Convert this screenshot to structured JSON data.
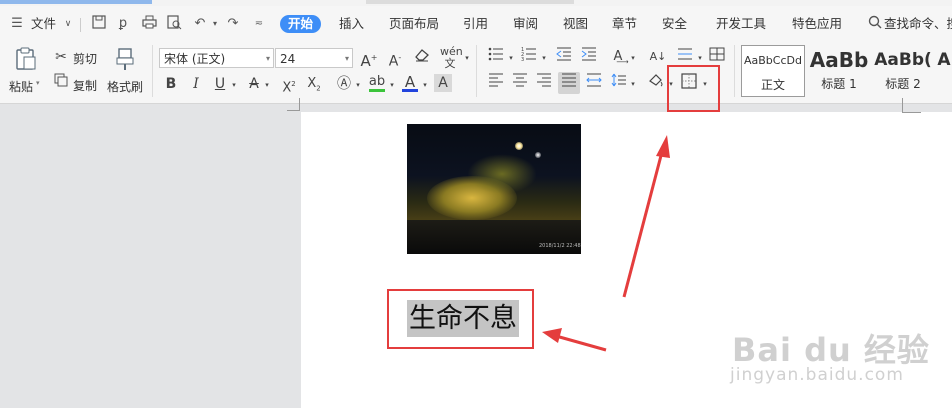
{
  "menu": {
    "file_label": "文件",
    "tabs": [
      {
        "label": "开始",
        "active": true
      },
      {
        "label": "插入"
      },
      {
        "label": "页面布局"
      },
      {
        "label": "引用"
      },
      {
        "label": "审阅"
      },
      {
        "label": "视图"
      },
      {
        "label": "章节"
      },
      {
        "label": "安全"
      },
      {
        "label": "开发工具"
      },
      {
        "label": "特色应用"
      }
    ],
    "search_label": "查找命令、搜"
  },
  "ribbon": {
    "paste_label": "粘贴",
    "cut_label": "剪切",
    "copy_label": "复制",
    "format_painter_label": "格式刷",
    "font_name": "宋体 (正文)",
    "font_size": "24",
    "styles": [
      {
        "sample": "AaBbCcDd",
        "name": "正文"
      },
      {
        "sample": "AaBb",
        "name": "标题 1"
      },
      {
        "sample": "AaBb(",
        "name": "标题 2"
      },
      {
        "sample": "A",
        "name": ""
      }
    ]
  },
  "document": {
    "photo_timestamp": "2018/11/2 22:48",
    "heading_text": "生命不息"
  },
  "watermark": {
    "logo": "Bai du 经验",
    "url": "jingyan.baidu.com"
  },
  "colors": {
    "accent": "#3e8ef7",
    "annotation_red": "#e43d3d",
    "highlight_gray": "#c4c4c4",
    "font_color_underline": "#2244dd",
    "highlight_green": "#3bc43b"
  }
}
